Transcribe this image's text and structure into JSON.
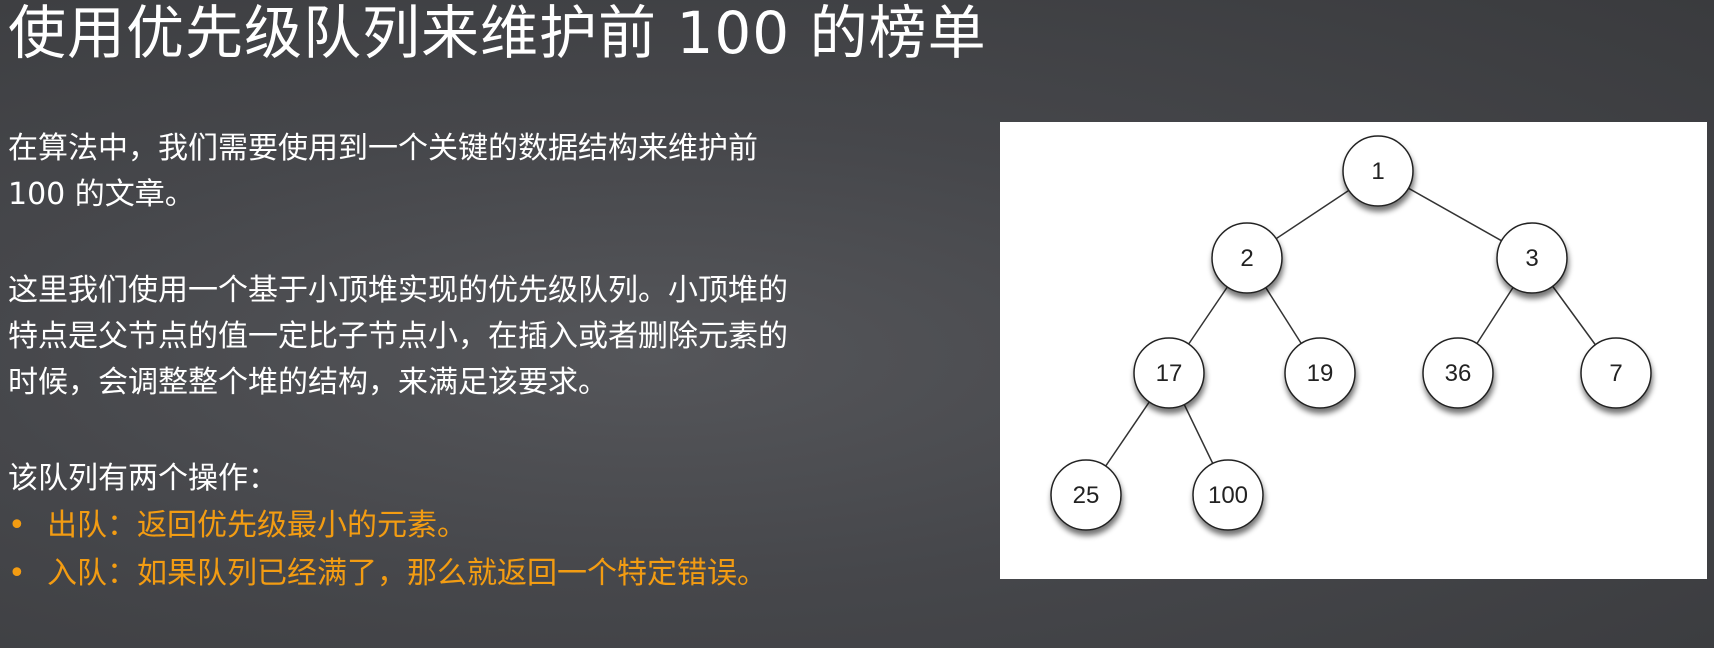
{
  "slide": {
    "title": "使用优先级队列来维护前 100 的榜单",
    "paragraphs": [
      [
        "在算法中，我们需要使用到一个关键的数据结构来维护前",
        "100 的文章。"
      ],
      [
        "这里我们使用一个基于小顶堆实现的优先级队列。小顶堆的",
        "特点是父节点的值一定比子节点小，在插入或者删除元素的",
        "时候，会调整整个堆的结构，来满足该要求。"
      ]
    ],
    "ops_intro": "该队列有两个操作：",
    "bullet_glyph": "•",
    "bullets": [
      "出队：返回优先级最小的元素。",
      "入队：如果队列已经满了，那么就返回一个特定错误。"
    ],
    "bullet_color": "#f39c12"
  },
  "heap_diagram": {
    "nodes": [
      {
        "id": "n1",
        "label": "1"
      },
      {
        "id": "n2",
        "label": "2"
      },
      {
        "id": "n3",
        "label": "3"
      },
      {
        "id": "n17",
        "label": "17"
      },
      {
        "id": "n19",
        "label": "19"
      },
      {
        "id": "n36",
        "label": "36"
      },
      {
        "id": "n7",
        "label": "7"
      },
      {
        "id": "n25",
        "label": "25"
      },
      {
        "id": "n100",
        "label": "100"
      }
    ],
    "edges": [
      [
        "n1",
        "n2"
      ],
      [
        "n1",
        "n3"
      ],
      [
        "n2",
        "n17"
      ],
      [
        "n2",
        "n19"
      ],
      [
        "n3",
        "n36"
      ],
      [
        "n3",
        "n7"
      ],
      [
        "n17",
        "n25"
      ],
      [
        "n17",
        "n100"
      ]
    ]
  }
}
